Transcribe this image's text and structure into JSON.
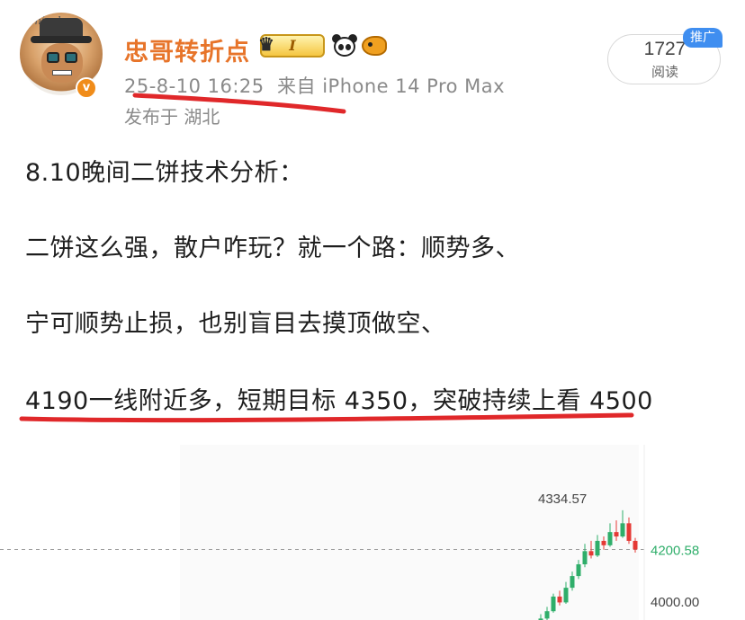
{
  "author": {
    "avatar_text": "Amicab",
    "username": "忠哥转折点",
    "level_badge": "I",
    "verified_mark": "v"
  },
  "post_meta": {
    "timestamp": "25-8-10 16:25",
    "source": "来自 iPhone 14 Pro Max",
    "location": "发布于 湖北"
  },
  "stats": {
    "reads": "1727",
    "reads_label": "阅读",
    "promo_label": "推广"
  },
  "post": {
    "lines": [
      "8.10晚间二饼技术分析：",
      "二饼这么强，散户咋玩？就一个路：顺势多、",
      "宁可顺势止损，也别盲目去摸顶做空、",
      "4190一线附近多，短期目标 4350，突破持续上看 4500"
    ]
  },
  "colors": {
    "username": "#e7742a",
    "underline": "#e0282a",
    "up_candle": "#2fae6a",
    "down_candle": "#e53935",
    "price_label": "#2fae6a"
  },
  "chart_data": {
    "type": "candlestick",
    "price_labels": {
      "high": "4334.57",
      "current": "4200.58",
      "axis_tick": "4000.00"
    },
    "current_price": 4200.58,
    "high_price": 4334.57,
    "ylim": [
      3960,
      4380
    ],
    "candles": [
      {
        "o": 3940,
        "c": 3965,
        "h": 3980,
        "l": 3930
      },
      {
        "o": 3965,
        "c": 3990,
        "h": 4005,
        "l": 3955
      },
      {
        "o": 3990,
        "c": 4040,
        "h": 4050,
        "l": 3985
      },
      {
        "o": 4040,
        "c": 4020,
        "h": 4060,
        "l": 4010
      },
      {
        "o": 4020,
        "c": 4070,
        "h": 4090,
        "l": 4015
      },
      {
        "o": 4070,
        "c": 4110,
        "h": 4125,
        "l": 4060
      },
      {
        "o": 4110,
        "c": 4150,
        "h": 4165,
        "l": 4100
      },
      {
        "o": 4150,
        "c": 4195,
        "h": 4220,
        "l": 4140
      },
      {
        "o": 4195,
        "c": 4180,
        "h": 4230,
        "l": 4170
      },
      {
        "o": 4180,
        "c": 4230,
        "h": 4250,
        "l": 4175
      },
      {
        "o": 4230,
        "c": 4215,
        "h": 4245,
        "l": 4200
      },
      {
        "o": 4215,
        "c": 4260,
        "h": 4290,
        "l": 4210
      },
      {
        "o": 4260,
        "c": 4245,
        "h": 4300,
        "l": 4230
      },
      {
        "o": 4245,
        "c": 4290,
        "h": 4334.57,
        "l": 4240
      },
      {
        "o": 4290,
        "c": 4230,
        "h": 4310,
        "l": 4220
      },
      {
        "o": 4230,
        "c": 4200.58,
        "h": 4240,
        "l": 4190
      }
    ]
  }
}
